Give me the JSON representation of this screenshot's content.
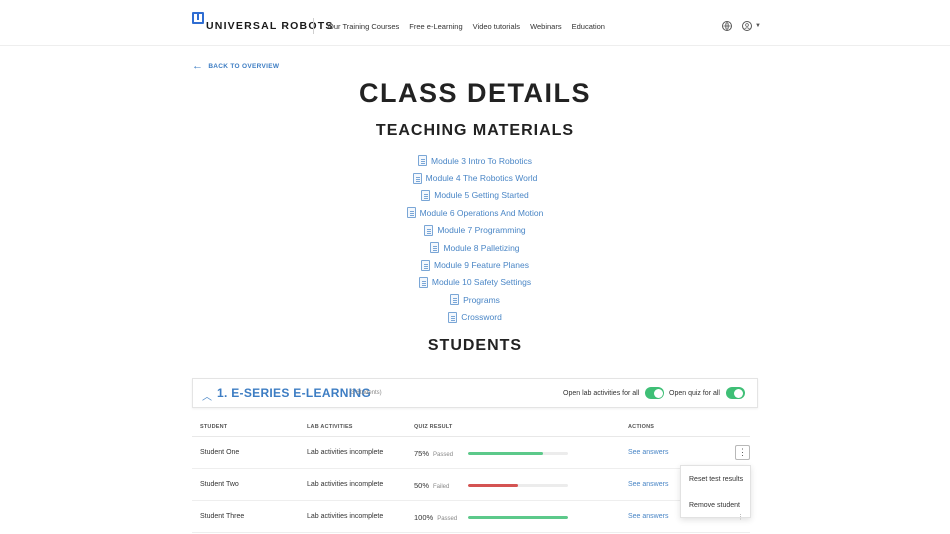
{
  "header": {
    "brand": "UNIVERSAL ROBOTS",
    "nav": [
      "Our Training Courses",
      "Free e-Learning",
      "Video tutorials",
      "Webinars",
      "Education"
    ],
    "icons": [
      "globe-icon",
      "user-icon",
      "chevron-down-icon"
    ]
  },
  "back_link": "BACK TO OVERVIEW",
  "page_title": "CLASS DETAILS",
  "teaching": {
    "title": "TEACHING MATERIALS",
    "items": [
      "Module 3 Intro To Robotics",
      "Module 4 The Robotics World",
      "Module 5 Getting Started",
      "Module 6 Operations And Motion",
      "Module 7 Programming",
      "Module 8 Palletizing",
      "Module 9 Feature Planes",
      "Module 10 Safety Settings",
      "Programs",
      "Crossword"
    ]
  },
  "students_title": "STUDENTS",
  "class_panel": {
    "title": "1. E-SERIES E-LEARNING",
    "count": "(3 Students)",
    "toggle_lab_label": "Open lab activities for all",
    "toggle_quiz_label": "Open quiz for all",
    "toggle_lab_on": true,
    "toggle_quiz_on": true
  },
  "table": {
    "columns": [
      "STUDENT",
      "LAB ACTIVITIES",
      "QUIZ RESULT",
      "ACTIONS"
    ],
    "rows": [
      {
        "student": "Student One",
        "lab": "Lab activities incomplete",
        "quiz_pct": "75%",
        "quiz_status": "Passed",
        "progress": 0.75,
        "bar_color": "#5cc98a",
        "action": "See answers"
      },
      {
        "student": "Student Two",
        "lab": "Lab activities incomplete",
        "quiz_pct": "50%",
        "quiz_status": "Failed",
        "progress": 0.5,
        "bar_color": "#d45352",
        "action": "See answers"
      },
      {
        "student": "Student Three",
        "lab": "Lab activities incomplete",
        "quiz_pct": "100%",
        "quiz_status": "Passed",
        "progress": 1.0,
        "bar_color": "#5cc98a",
        "action": "See answers"
      }
    ]
  },
  "row_menu": {
    "trigger": "⋮",
    "items": [
      "Reset test results",
      "Remove student"
    ]
  },
  "colors": {
    "accent": "#3d7dc3",
    "link": "#4a86c6",
    "toggle_on": "#3fbf76"
  }
}
